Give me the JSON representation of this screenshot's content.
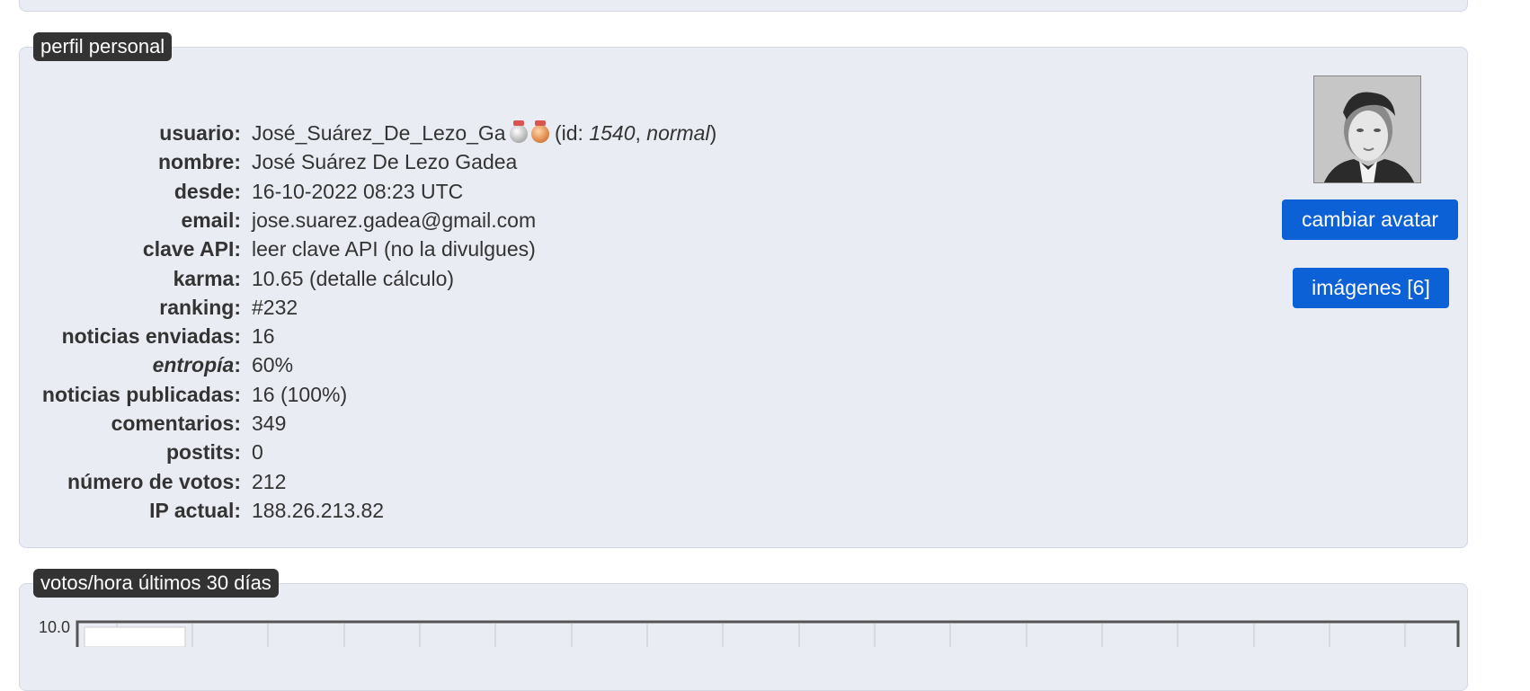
{
  "profile_section": {
    "title": "perfil personal",
    "rows": [
      {
        "label": "usuario:",
        "value": "José_Suárez_De_Lezo_Ga",
        "id_prefix": " (id: ",
        "id": "1540",
        "sep": ", ",
        "level": "normal",
        "id_suffix": ")"
      },
      {
        "label": "nombre:",
        "value": "José Suárez De Lezo Gadea"
      },
      {
        "label": "desde:",
        "value": "16-10-2022 08:23 UTC"
      },
      {
        "label": "email:",
        "value": "jose.suarez.gadea@gmail.com"
      },
      {
        "label": "clave API:",
        "value": "leer clave API (no la divulgues)"
      },
      {
        "label": "karma:",
        "value": "10.65 (detalle cálculo)"
      },
      {
        "label": "ranking:",
        "value": "#232"
      },
      {
        "label": "noticias enviadas:",
        "value": "16"
      },
      {
        "label_italic": "entropía",
        "label_suffix": ":",
        "value": "60%"
      },
      {
        "label": "noticias publicadas:",
        "value": "16 (100%)"
      },
      {
        "label": "comentarios:",
        "value": "349"
      },
      {
        "label": "postits:",
        "value": "0"
      },
      {
        "label": "número de votos:",
        "value": "212"
      },
      {
        "label": "IP actual:",
        "value": "188.26.213.82"
      }
    ],
    "buttons": {
      "change_avatar": "cambiar avatar",
      "images": "imágenes [6]"
    },
    "medals": [
      "silver",
      "bronze"
    ]
  },
  "chart_section": {
    "title": "votos/hora últimos 30 días",
    "chart_data": {
      "type": "line",
      "ylim_top_label": "10.0",
      "series": []
    }
  },
  "colors": {
    "panel_bg": "#e9ecf3",
    "legend_bg": "#333333",
    "button_bg": "#0d61d6"
  }
}
